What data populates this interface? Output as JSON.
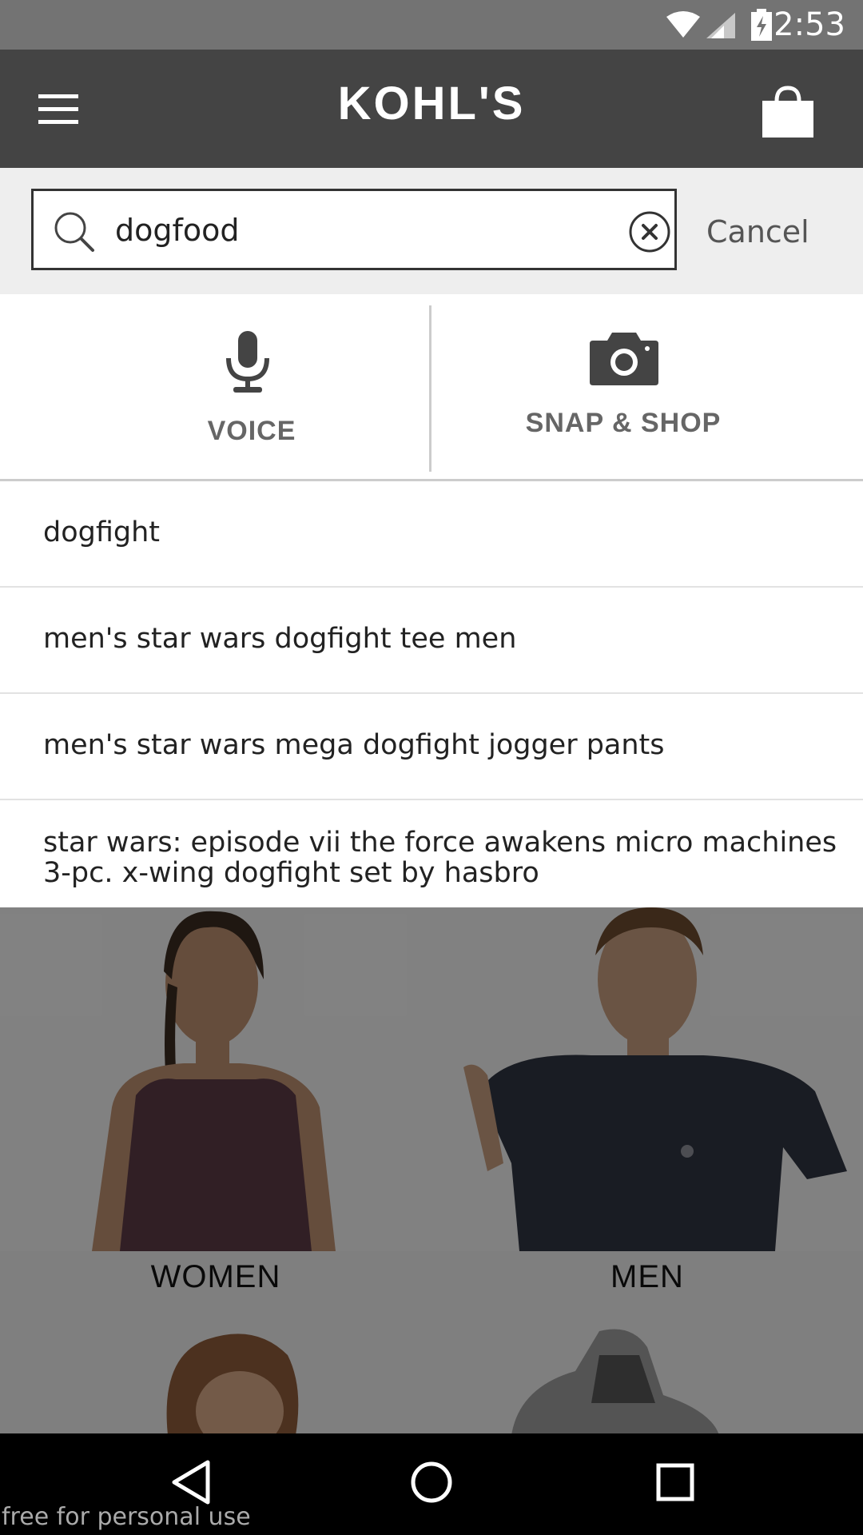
{
  "status_bar": {
    "time": "2:53",
    "icons": [
      "wifi-icon",
      "signal-icon",
      "battery-charging-icon"
    ]
  },
  "app_bar": {
    "logo_text": "KOHL'S",
    "menu_icon": "hamburger-menu-icon",
    "bag_icon": "shopping-bag-icon",
    "background": "#444444"
  },
  "search": {
    "value": "dogfood",
    "search_icon": "search-icon",
    "clear_icon": "clear-circle-x-icon",
    "cancel_label": "Cancel"
  },
  "options": {
    "voice": {
      "icon": "microphone-icon",
      "label": "VOICE"
    },
    "snap": {
      "icon": "camera-icon",
      "label": "SNAP & SHOP"
    }
  },
  "suggestions": [
    "dogfight",
    "men's star wars dogfight tee men",
    "men's star wars mega dogfight jogger pants",
    "star wars: episode vii the force awakens micro machines 3-pc. x-wing dogfight set by hasbro"
  ],
  "categories": [
    {
      "label": "WOMEN"
    },
    {
      "label": "MEN"
    }
  ],
  "nav_bar": {
    "icons": [
      "back-icon",
      "home-icon",
      "recents-icon"
    ]
  },
  "watermark": "free for personal use"
}
